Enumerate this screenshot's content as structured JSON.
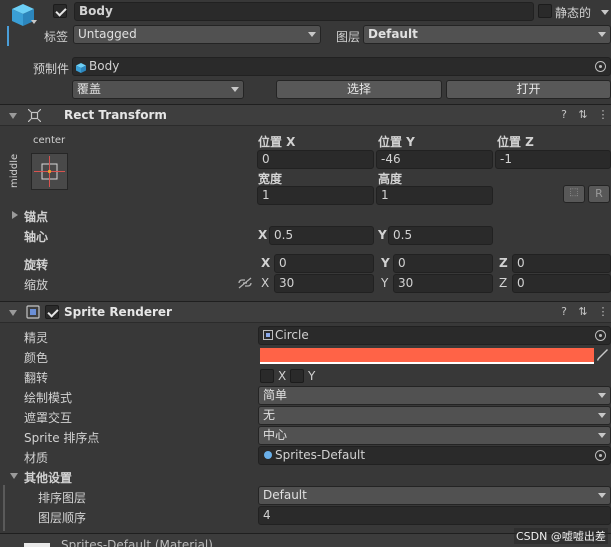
{
  "gameobject": {
    "name": "Body",
    "static_label": "静态的",
    "tag_label": "标签",
    "tag_value": "Untagged",
    "layer_label": "图层",
    "layer_value": "Default",
    "prefab_label": "预制件",
    "prefab_value": "Body",
    "overrides_label": "覆盖",
    "select_label": "选择",
    "open_label": "打开"
  },
  "rect_transform": {
    "title": "Rect Transform",
    "anchor_h": "center",
    "anchor_v": "middle",
    "pos_x_label": "位置 X",
    "pos_y_label": "位置 Y",
    "pos_z_label": "位置 Z",
    "pos_x": "0",
    "pos_y": "-46",
    "pos_z": "-1",
    "width_label": "宽度",
    "height_label": "高度",
    "width": "1",
    "height": "1",
    "r_label": "R",
    "anchors_label": "锚点",
    "pivot_label": "轴心",
    "pivot_x": "0.5",
    "pivot_y": "0.5",
    "rotation_label": "旋转",
    "rot_x": "0",
    "rot_y": "0",
    "rot_z": "0",
    "scale_label": "缩放",
    "scale_x": "30",
    "scale_y": "30",
    "scale_z": "0",
    "x": "X",
    "y": "Y",
    "z": "Z"
  },
  "sprite_renderer": {
    "title": "Sprite Renderer",
    "sprite_label": "精灵",
    "sprite_value": "Circle",
    "color_label": "颜色",
    "color_value": "#ff6347",
    "flip_label": "翻转",
    "flip_x": "X",
    "flip_y": "Y",
    "draw_mode_label": "绘制模式",
    "draw_mode_value": "简单",
    "mask_label": "遮罩交互",
    "mask_value": "无",
    "sort_point_label": "Sprite 排序点",
    "sort_point_value": "中心",
    "material_label": "材质",
    "material_value": "Sprites-Default",
    "other_label": "其他设置",
    "sorting_layer_label": "排序图层",
    "sorting_layer_value": "Default",
    "order_label": "图层顺序",
    "order_value": "4"
  },
  "material_footer": {
    "label": "Sprites-Default (Material)"
  },
  "watermark": "CSDN @嘘嘘出差"
}
